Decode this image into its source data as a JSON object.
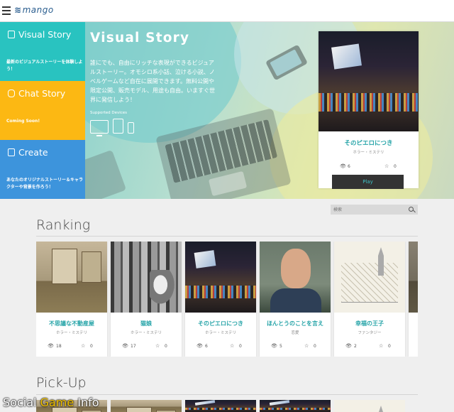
{
  "header": {
    "logo_text": "mango"
  },
  "menu": {
    "items": [
      {
        "title": "Visual Story",
        "desc": "最新のビジュアルストーリーを体験しよう！",
        "color": "#29c3c0"
      },
      {
        "title": "Chat Story",
        "desc": "Coming Soon!",
        "color": "#fcb813"
      },
      {
        "title": "Create",
        "desc": "あなたのオリジナルストーリー＆キャラクターや背景を作ろう！",
        "color": "#3d94dc"
      }
    ]
  },
  "hero": {
    "title": "Visual Story",
    "description": "誰にでも、自由にリッチな表現ができるビジュアルストーリー。オモシロ系小話、泣ける小説、ノベルゲームなど自在に展開できます。無料公開や限定公開、販売モデル、用途も自由。いますぐ世界に発信しよう！",
    "supported_label": "Supported Devices",
    "devices": [
      "monitor-icon",
      "tablet-icon",
      "phone-icon"
    ],
    "feature_card": {
      "title": "そのピエロにつき",
      "genre": "ホラー・ミステリ",
      "views": "6",
      "stars": "0",
      "play_label": "Play"
    }
  },
  "search": {
    "placeholder": "検索"
  },
  "ranking": {
    "title": "Ranking",
    "cards": [
      {
        "title": "不思議な不動産屋",
        "genre": "ホラー・ミステリ",
        "views": "18",
        "stars": "0",
        "image": "room"
      },
      {
        "title": "猫娘",
        "genre": "ホラー・ミステリ",
        "views": "17",
        "stars": "0",
        "image": "forest"
      },
      {
        "title": "そのピエロにつき",
        "genre": "ホラー・ミステリ",
        "views": "6",
        "stars": "0",
        "image": "city"
      },
      {
        "title": "ほんとうのことを言え",
        "genre": "恋愛",
        "views": "5",
        "stars": "0",
        "image": "man"
      },
      {
        "title": "幸福の王子",
        "genre": "ファンタジー",
        "views": "2",
        "stars": "0",
        "image": "sketch"
      }
    ]
  },
  "pickup": {
    "title": "Pick-Up"
  },
  "watermark": {
    "part1": "Social ",
    "part2": "Game",
    "part3": " Info"
  },
  "colors": {
    "teal": "#29c3c0",
    "yellow": "#fcb813",
    "blue": "#3d94dc",
    "title_teal": "#26a4a8"
  }
}
